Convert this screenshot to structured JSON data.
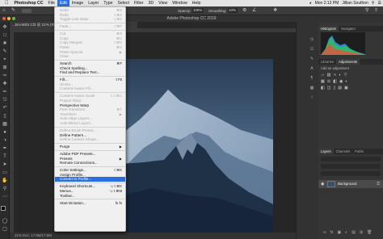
{
  "menubar": {
    "app_name": "Photoshop CC",
    "items": [
      "File",
      "Edit",
      "Image",
      "Layer",
      "Type",
      "Select",
      "Filter",
      "3D",
      "View",
      "Window",
      "Help"
    ],
    "active": "Edit",
    "clock": "Mon 2:12 PM",
    "user": "Jillian Southon"
  },
  "window_title": "Adobe Photoshop CC 2019",
  "document_tab": "...BAA80S.Cl3 @ 21% (R",
  "status_text": "21%    Doc: 17.5M/17.5M",
  "options": {
    "opacity_label": "Opacity:",
    "opacity_value": "100%",
    "smoothing_label": "Smoothing:",
    "smoothing_value": "10%"
  },
  "edit_menu": {
    "items": [
      {
        "label": "Undo",
        "shortcut": "⌘Z",
        "enabled": false
      },
      {
        "label": "Redo",
        "shortcut": "⇧⌘Z",
        "enabled": false
      },
      {
        "label": "Toggle Last State",
        "shortcut": "⌥⌘Z",
        "enabled": false
      },
      {
        "sep": true
      },
      {
        "label": "Fade...",
        "shortcut": "⇧⌘F",
        "enabled": false
      },
      {
        "sep": true
      },
      {
        "label": "Cut",
        "shortcut": "⌘X",
        "enabled": false
      },
      {
        "label": "Copy",
        "shortcut": "⌘C",
        "enabled": false
      },
      {
        "label": "Copy Merged",
        "shortcut": "⇧⌘C",
        "enabled": false
      },
      {
        "label": "Paste",
        "shortcut": "⌘V",
        "enabled": false
      },
      {
        "label": "Paste Special",
        "arrow": true,
        "enabled": false
      },
      {
        "label": "Clear",
        "enabled": false
      },
      {
        "sep": true
      },
      {
        "label": "Search",
        "shortcut": "⌘F",
        "enabled": true
      },
      {
        "label": "Check Spelling...",
        "enabled": true
      },
      {
        "label": "Find and Replace Text...",
        "enabled": true
      },
      {
        "sep": true
      },
      {
        "label": "Fill...",
        "shortcut": "⇧F5",
        "enabled": true
      },
      {
        "label": "Stroke...",
        "enabled": false
      },
      {
        "label": "Content-Aware Fill...",
        "enabled": false
      },
      {
        "sep": true
      },
      {
        "label": "Content-Aware Scale",
        "shortcut": "⌥⇧⌘C",
        "enabled": false
      },
      {
        "label": "Puppet Warp",
        "enabled": false
      },
      {
        "label": "Perspective Warp",
        "enabled": true
      },
      {
        "label": "Free Transform",
        "shortcut": "⌘T",
        "enabled": false
      },
      {
        "label": "Transform",
        "arrow": true,
        "enabled": false
      },
      {
        "label": "Auto-Align Layers...",
        "enabled": false
      },
      {
        "label": "Auto-Blend Layers...",
        "enabled": false
      },
      {
        "sep": true
      },
      {
        "label": "Define Brush Preset...",
        "enabled": false
      },
      {
        "label": "Define Pattern...",
        "enabled": true
      },
      {
        "label": "Define Custom Shape...",
        "enabled": false
      },
      {
        "sep": true
      },
      {
        "label": "Purge",
        "arrow": true,
        "enabled": true
      },
      {
        "sep": true
      },
      {
        "label": "Adobe PDF Presets...",
        "enabled": true
      },
      {
        "label": "Presets",
        "arrow": true,
        "enabled": true
      },
      {
        "label": "Remote Connections...",
        "enabled": true
      },
      {
        "sep": true
      },
      {
        "label": "Color Settings...",
        "shortcut": "⇧⌘K",
        "enabled": true
      },
      {
        "label": "Assign Profile...",
        "enabled": true
      },
      {
        "label": "Convert to Profile...",
        "enabled": true,
        "highlighted": true
      },
      {
        "sep": true
      },
      {
        "label": "Keyboard Shortcuts...",
        "shortcut": "⌥⇧⌘K",
        "enabled": true
      },
      {
        "label": "Menus...",
        "shortcut": "⌥⇧⌘M",
        "enabled": true
      },
      {
        "label": "Toolbar...",
        "enabled": true
      },
      {
        "sep": true
      },
      {
        "label": "Start Dictation...",
        "shortcut": "fn fn",
        "enabled": true
      }
    ]
  },
  "panels": {
    "top_tabs": [
      "Histogram",
      "Navigator"
    ],
    "mid_tabs": [
      "Libraries",
      "Adjustments"
    ],
    "adjust_label": "Add an adjustment",
    "bottom_tabs": [
      "Layers",
      "Channels",
      "Paths"
    ],
    "layer_name": "Background"
  },
  "colors": {
    "menu_highlight": "#2a6ee0",
    "menu_bg": "#f0f0f0",
    "canvas_dark": "#262626"
  }
}
